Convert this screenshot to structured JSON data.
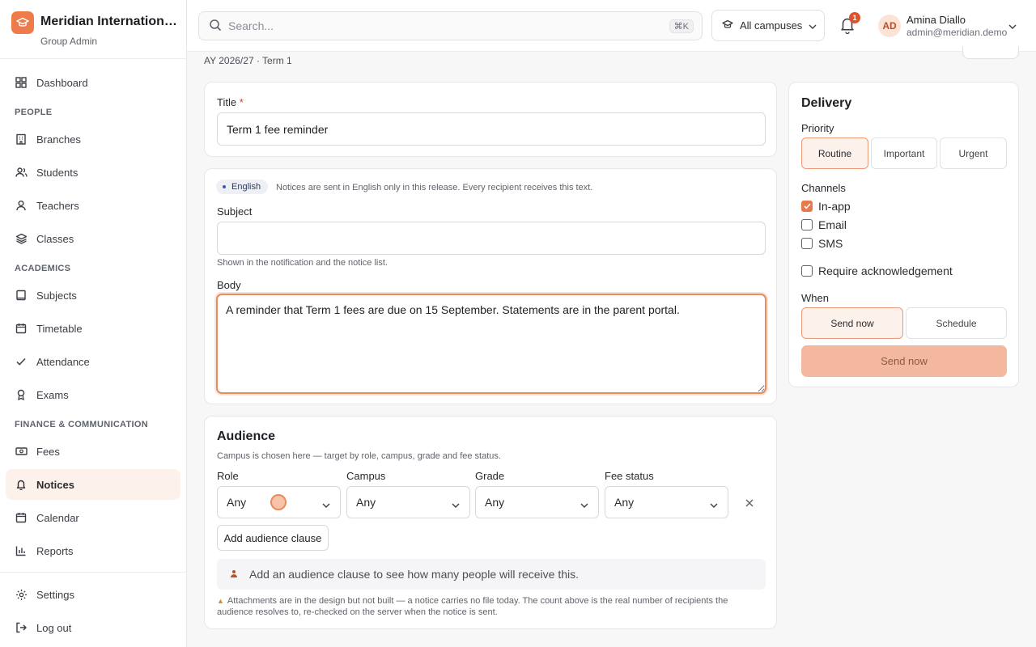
{
  "brand": {
    "name": "Meridian International School",
    "role": "Group Admin"
  },
  "nav": {
    "dashboard": "Dashboard",
    "people_section": "PEOPLE",
    "branches": "Branches",
    "students": "Students",
    "teachers": "Teachers",
    "classes": "Classes",
    "academics_section": "ACADEMICS",
    "subjects": "Subjects",
    "timetable": "Timetable",
    "attendance": "Attendance",
    "exams": "Exams",
    "finance_section": "FINANCE & COMMUNICATION",
    "fees": "Fees",
    "notices": "Notices",
    "calendar": "Calendar",
    "reports": "Reports",
    "settings": "Settings",
    "logout": "Log out"
  },
  "header": {
    "search_placeholder": "Search...",
    "search_shortcut": "⌘K",
    "campus": "All campuses",
    "notifications_count": "1",
    "user_initials": "AD",
    "user_name": "Amina Diallo",
    "user_email": "admin@meridian.demo"
  },
  "term": "AY 2026/27 · Term 1",
  "form": {
    "title_label": "Title",
    "title_required": "*",
    "title_value": "Term 1 fee reminder",
    "language": "English",
    "language_note": "Notices are sent in English only in this release. Every recipient receives this text.",
    "subject_label": "Subject",
    "subject_value": "",
    "subject_hint": "Shown in the notification and the notice list.",
    "body_label": "Body",
    "body_value": "A reminder that Term 1 fees are due on 15 September. Statements are in the parent portal."
  },
  "audience": {
    "title": "Audience",
    "subtitle": "Campus is chosen here — target by role, campus, grade and fee status.",
    "role_label": "Role",
    "role_value": "Any",
    "campus_label": "Campus",
    "campus_value": "Any",
    "grade_label": "Grade",
    "grade_value": "Any",
    "fee_label": "Fee status",
    "fee_value": "Any",
    "add_clause": "Add audience clause",
    "reach_text": "Add an audience clause to see how many people will receive this.",
    "attachments_note": "Attachments are in the design but not built — a notice carries no file today. The count above is the real number of recipients the audience resolves to, re-checked on the server when the notice is sent."
  },
  "delivery": {
    "title": "Delivery",
    "priority_label": "Priority",
    "priority_routine": "Routine",
    "priority_important": "Important",
    "priority_urgent": "Urgent",
    "channels_label": "Channels",
    "channel_inapp": "In-app",
    "channel_email": "Email",
    "channel_sms": "SMS",
    "require_ack": "Require acknowledgement",
    "when_label": "When",
    "when_now": "Send now",
    "when_schedule": "Schedule",
    "send_button": "Send now"
  },
  "colors": {
    "accent": "#e9784a",
    "accent_soft": "#fdf1ec",
    "send_disabled": "#f4b89f"
  }
}
